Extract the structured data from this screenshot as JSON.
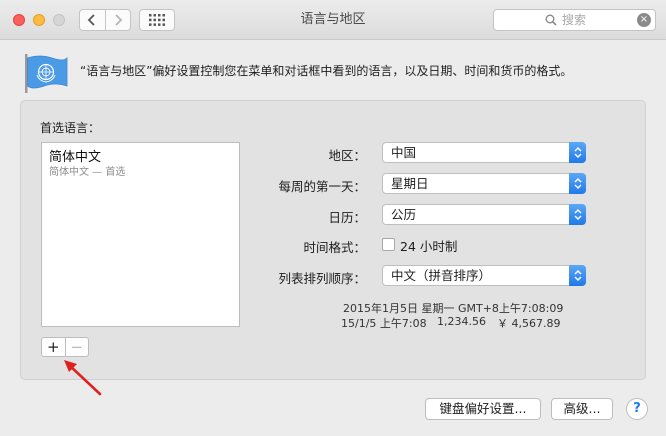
{
  "window": {
    "title": "语言与地区",
    "search_placeholder": "搜索",
    "search_clear": "×"
  },
  "description": "“语言与地区”偏好设置控制您在菜单和对话框中看到的语言，以及日期、时间和货币的格式。",
  "languages": {
    "title": "首选语言：",
    "items": [
      {
        "name": "简体中文",
        "subtitle": "简体中文 — 首选"
      }
    ],
    "add_label": "+",
    "remove_label": "−"
  },
  "settings": {
    "region": {
      "label": "地区：",
      "value": "中国"
    },
    "first_day": {
      "label": "每周的第一天：",
      "value": "星期日"
    },
    "calendar": {
      "label": "日历：",
      "value": "公历"
    },
    "time_format": {
      "label": "时间格式：",
      "checkbox_label": "24 小时制",
      "checked": false
    },
    "sort_order": {
      "label": "列表排列顺序：",
      "value": "中文（拼音排序）"
    }
  },
  "sample": {
    "line1": "2015年1月5日 星期一 GMT+8上午7:08:09",
    "date_short": "15/1/5 上午7:08",
    "number": "1,234.56",
    "currency": "￥ 4,567.89"
  },
  "buttons": {
    "keyboard": "键盘偏好设置...",
    "advanced": "高级...",
    "help": "?"
  },
  "colors": {
    "accent": "#1f7ae8",
    "annotation_arrow": "#e02020"
  }
}
